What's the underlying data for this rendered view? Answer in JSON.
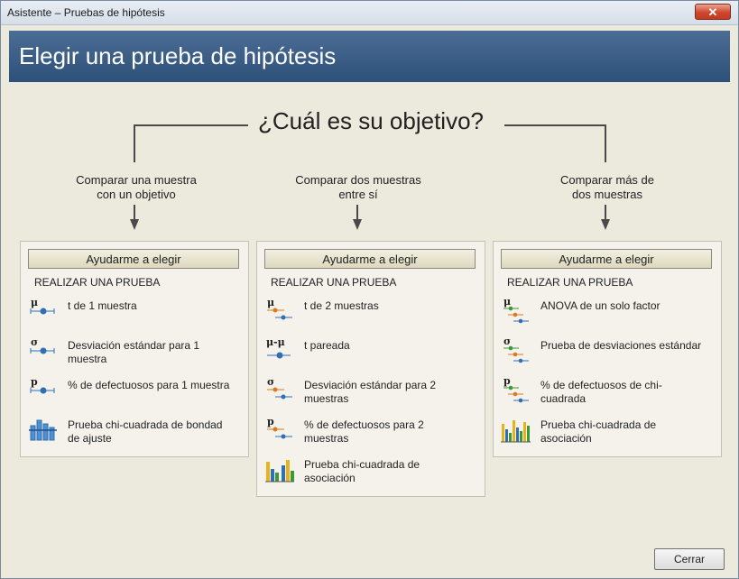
{
  "window": {
    "title": "Asistente – Pruebas de hipótesis",
    "close_glyph": "✕"
  },
  "header": {
    "title": "Elegir una prueba de hipótesis"
  },
  "question": "¿Cuál es su objetivo?",
  "branches": [
    {
      "line1": "Comparar una muestra",
      "line2": "con un objetivo"
    },
    {
      "line1": "Comparar dos muestras",
      "line2": "entre sí"
    },
    {
      "line1": "Comparar más de",
      "line2": "dos muestras"
    }
  ],
  "panels": [
    {
      "help_button": "Ayudarme a elegir",
      "heading": "REALIZAR UNA PRUEBA",
      "items": [
        {
          "icon": "mu-one-sample-icon",
          "symbol": "μ",
          "line1": "t de 1 muestra",
          "line2": ""
        },
        {
          "icon": "sigma-one-sample-icon",
          "symbol": "σ",
          "line1": "Desviación estándar para 1",
          "line2": "muestra"
        },
        {
          "icon": "p-one-sample-icon",
          "symbol": "p",
          "line1": "% de defectuosos para 1 muestra",
          "line2": ""
        },
        {
          "icon": "bar-chart-icon",
          "symbol": "",
          "line1": "Prueba chi-cuadrada de bondad",
          "line2": "de ajuste"
        }
      ]
    },
    {
      "help_button": "Ayudarme a elegir",
      "heading": "REALIZAR UNA PRUEBA",
      "items": [
        {
          "icon": "mu-two-sample-icon",
          "symbol": "μ",
          "line1": "t de 2 muestras",
          "line2": ""
        },
        {
          "icon": "mu-paired-icon",
          "symbol": "μ-μ",
          "line1": "t pareada",
          "line2": ""
        },
        {
          "icon": "sigma-two-sample-icon",
          "symbol": "σ",
          "line1": "Desviación estándar para 2",
          "line2": "muestras"
        },
        {
          "icon": "p-two-sample-icon",
          "symbol": "p",
          "line1": "% de defectuosos para 2",
          "line2": "muestras"
        },
        {
          "icon": "grouped-bar-chart-icon",
          "symbol": "",
          "line1": "Prueba chi-cuadrada de",
          "line2": "asociación"
        }
      ]
    },
    {
      "help_button": "Ayudarme a elegir",
      "heading": "REALIZAR UNA PRUEBA",
      "items": [
        {
          "icon": "mu-multi-sample-icon",
          "symbol": "μ",
          "line1": "ANOVA de un solo factor",
          "line2": ""
        },
        {
          "icon": "sigma-multi-sample-icon",
          "symbol": "σ",
          "line1": "Prueba de desviaciones estándar",
          "line2": ""
        },
        {
          "icon": "p-multi-sample-icon",
          "symbol": "p",
          "line1": "% de defectuosos de chi-",
          "line2": "cuadrada"
        },
        {
          "icon": "multi-bar-chart-icon",
          "symbol": "",
          "line1": "Prueba chi-cuadrada de",
          "line2": "asociación"
        }
      ]
    }
  ],
  "footer": {
    "close_button": "Cerrar"
  },
  "colors": {
    "header_blue": "#2d5079",
    "dot_blue": "#2f6fb5",
    "dot_orange": "#d97a1e",
    "dot_green": "#3a9a3a",
    "bar_gold": "#e8b21a"
  }
}
